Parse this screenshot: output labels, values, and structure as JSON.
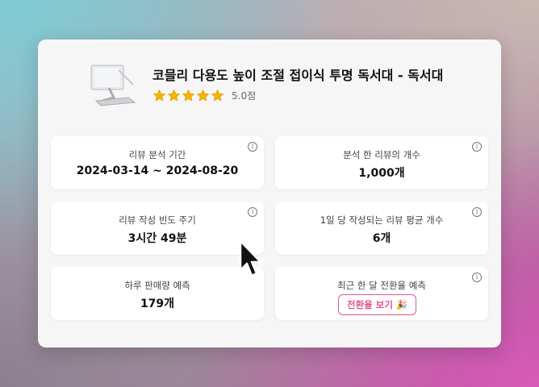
{
  "product": {
    "title": "코믈리 다용도 높이 조절 접이식 투명 독서대 - 독서대",
    "rating_text": "5.0점",
    "stars": 5
  },
  "stats": {
    "review_period_label": "리뷰 분석 기간",
    "review_period_value": "2024-03-14 ~ 2024-08-20",
    "review_count_label": "분석 한 리뷰의 개수",
    "review_count_value": "1,000개",
    "frequency_label": "리뷰 작성 빈도 주기",
    "frequency_value": "3시간 49분",
    "daily_avg_label": "1일 당 작성되는 리뷰 평균 개수",
    "daily_avg_value": "6개",
    "daily_sales_label": "하루 판매량 예측",
    "daily_sales_value": "179개",
    "conversion_label": "최근 한 달 전환율 예측",
    "conversion_button": "전환율 보기",
    "conversion_emoji": "🎉"
  },
  "icons": {
    "info": "info-icon",
    "star": "star-icon",
    "cursor": "mouse-cursor-icon"
  },
  "colors": {
    "accent": "#e25591",
    "star": "#f5b400"
  }
}
